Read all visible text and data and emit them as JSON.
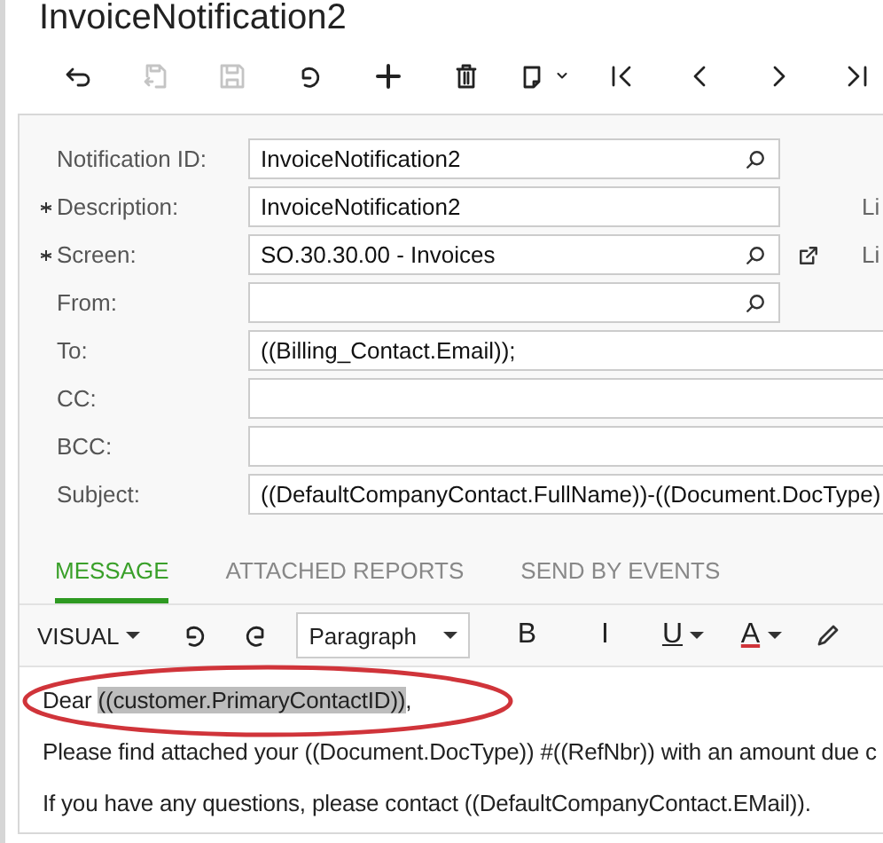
{
  "title": "InvoiceNotification2",
  "toolbar": [
    {
      "kind": "back",
      "disabled": false
    },
    {
      "kind": "save-close",
      "disabled": true
    },
    {
      "kind": "save",
      "disabled": true
    },
    {
      "kind": "undo",
      "disabled": false
    },
    {
      "kind": "add",
      "disabled": false
    },
    {
      "kind": "delete",
      "disabled": false
    },
    {
      "kind": "copy-paste",
      "disabled": false
    },
    {
      "kind": "first",
      "disabled": false
    },
    {
      "kind": "previous",
      "disabled": false
    },
    {
      "kind": "next",
      "disabled": false
    },
    {
      "kind": "last",
      "disabled": false
    }
  ],
  "fields": [
    {
      "label": "Notification ID:",
      "value": "InvoiceNotification2",
      "required": false,
      "lookup": true,
      "short": true
    },
    {
      "label": "Description:",
      "value": "InvoiceNotification2",
      "required": true,
      "lookup": false,
      "short": true,
      "side_label": "Li"
    },
    {
      "label": "Screen:",
      "value": "SO.30.30.00 - Invoices",
      "required": true,
      "lookup": true,
      "short": true,
      "open_link": true,
      "side_label": "Li"
    },
    {
      "label": "From:",
      "required": false,
      "lookup": true,
      "short": true
    },
    {
      "label": "To:",
      "value": "((Billing_Contact.Email));",
      "required": false,
      "lookup": false,
      "short": false
    },
    {
      "label": "CC:",
      "required": false,
      "lookup": false,
      "short": false
    },
    {
      "label": "BCC:",
      "required": false,
      "lookup": false,
      "short": false
    },
    {
      "label": "Subject:",
      "value": "((DefaultCompanyContact.FullName))-((Document.DocType)",
      "required": false,
      "lookup": false,
      "short": false
    }
  ],
  "tabs": [
    {
      "label": "MESSAGE",
      "selected": true
    },
    {
      "label": "ATTACHED REPORTS",
      "selected": false
    },
    {
      "label": "SEND BY EVENTS",
      "selected": false
    }
  ],
  "editor_toolbar": {
    "mode": "VISUAL",
    "format": "Paragraph",
    "bold": "B",
    "italic": "I",
    "underline": "U",
    "font_color": "A"
  },
  "message": [
    {
      "segments": [
        {
          "text": "Dear ",
          "highlighted": false
        },
        {
          "text": "((customer.PrimaryContactID))",
          "highlighted": true
        },
        {
          "text": ",",
          "highlighted": false
        }
      ],
      "circled": true
    },
    {
      "segments": [
        {
          "text": "Please find attached your ((Document.DocType)) #((RefNbr)) with an amount due c",
          "highlighted": false
        }
      ],
      "circled": false
    },
    {
      "segments": [
        {
          "text": "If you have any questions, please contact ((DefaultCompanyContact.EMail)).",
          "highlighted": false
        }
      ],
      "circled": false
    }
  ]
}
